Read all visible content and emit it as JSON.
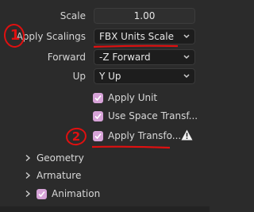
{
  "fields": {
    "scale_label": "Scale",
    "scale_value": "1.00",
    "apply_scalings_label": "Apply Scalings",
    "apply_scalings_value": "FBX Units Scale",
    "forward_label": "Forward",
    "forward_value": "-Z Forward",
    "up_label": "Up",
    "up_value": "Y Up"
  },
  "checks": {
    "apply_unit": "Apply Unit",
    "use_space_transform": "Use Space Transf...",
    "apply_transform": "Apply Transfo..."
  },
  "sections": {
    "geometry": "Geometry",
    "armature": "Armature",
    "animation": "Animation"
  },
  "annotations": {
    "mark_1": "1",
    "mark_2": "2"
  },
  "colors": {
    "panel_bg": "#2b2b2b",
    "checkbox_on": "#d7a3d8",
    "annotation_red": "#e01010",
    "warning_icon": "#f2f2f2"
  },
  "icons": {
    "dropdown": "chevron-down-icon",
    "collapsed": "chevron-right-icon",
    "warning": "warning-icon"
  }
}
